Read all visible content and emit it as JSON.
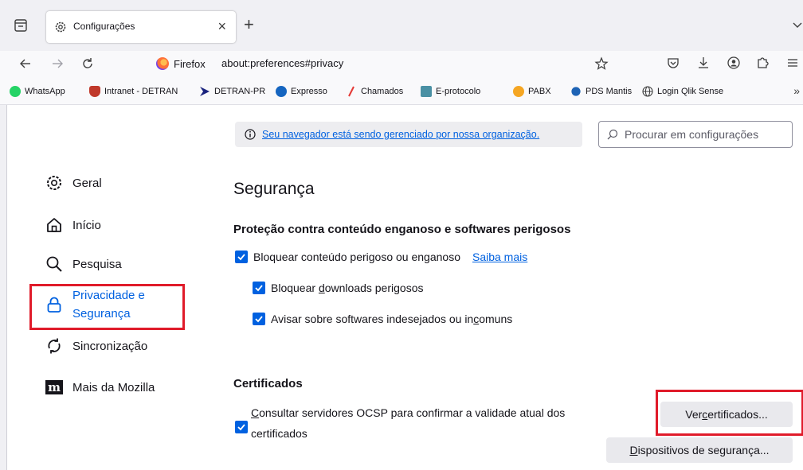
{
  "tab": {
    "title": "Configurações",
    "close": "×"
  },
  "new_tab": "+",
  "urlbar": {
    "identity": "Firefox",
    "url": "about:preferences#privacy"
  },
  "bookmarks": [
    {
      "label": "WhatsApp",
      "color": "#25d366"
    },
    {
      "label": "Intranet - DETRAN",
      "color": "#c0392b"
    },
    {
      "label": "DETRAN-PR",
      "color": "#1a237e"
    },
    {
      "label": "Expresso",
      "color": "#1565c0"
    },
    {
      "label": "Chamados",
      "color": "#e53935"
    },
    {
      "label": "E-protocolo",
      "color": "#4a90a4"
    },
    {
      "label": "PABX",
      "color": "#f5a623"
    },
    {
      "label": "PDS Mantis",
      "color": "#1e63b5"
    },
    {
      "label": "Login Qlik Sense",
      "color": "#3c3c3c"
    }
  ],
  "bookmarks_overflow": "»",
  "policy_notice": "Seu navegador está sendo gerenciado por nossa organização.",
  "search": {
    "placeholder": "Procurar em configurações"
  },
  "categories": [
    {
      "label": "Geral",
      "icon": "gear-icon"
    },
    {
      "label": "Início",
      "icon": "home-icon"
    },
    {
      "label": "Pesquisa",
      "icon": "search-icon"
    },
    {
      "label_line1": "Privacidade e",
      "label_line2": "Segurança",
      "icon": "lock-icon",
      "selected": true
    },
    {
      "label": "Sincronização",
      "icon": "sync-icon"
    },
    {
      "label": "Mais da Mozilla",
      "icon": "mozilla-m-icon"
    }
  ],
  "security": {
    "heading": "Segurança",
    "subheading": "Proteção contra conteúdo enganoso e softwares perigosos",
    "block_dangerous": {
      "label": "Bloquear conteúdo perigoso ou enganoso",
      "link": "Saiba mais",
      "checked": true
    },
    "block_downloads": {
      "pre": "Bloquear ",
      "accel": "d",
      "post": "ownloads perigosos",
      "checked": true
    },
    "warn_software": {
      "pre": "Avisar sobre softwares indesejados ou in",
      "accel": "c",
      "post": "omuns",
      "checked": true
    }
  },
  "certificates": {
    "heading": "Certificados",
    "ocsp": {
      "accel": "C",
      "rest_line1": "onsultar servidores OCSP para confirmar a validade atual dos",
      "line2": "certificados",
      "checked": true
    },
    "view_button": {
      "pre": "Ver ",
      "accel": "c",
      "post": "ertificados..."
    },
    "devices_button": {
      "accel": "D",
      "post": "ispositivos de segurança..."
    }
  },
  "colors": {
    "accent": "#0061e0",
    "highlight_box": "#e01b2a"
  }
}
